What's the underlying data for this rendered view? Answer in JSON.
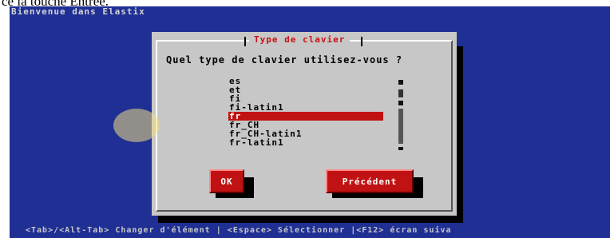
{
  "doc_fragment": "ce la touche Entrée.",
  "screen": {
    "title": "Bienvenue dans Elastix",
    "status_bar": "<Tab>/<Alt-Tab> Changer d'élément  |  <Espace> Sélectionner |<F12> écran suiva"
  },
  "dialog": {
    "title": "Type de clavier",
    "question": "Quel type de clavier utilisez-vous ?",
    "keyboard_list": [
      "es",
      "et",
      "fi",
      "fi-latin1",
      "fr",
      "fr_CH",
      "fr_CH-latin1",
      "fr-latin1"
    ],
    "selected_keyboard": "fr",
    "ok_label": "OK",
    "back_label": "Précédent"
  },
  "colors": {
    "screen_background": "#1f2f94",
    "dialog_background": "#c7c7c7",
    "accent_red": "#c01212"
  }
}
